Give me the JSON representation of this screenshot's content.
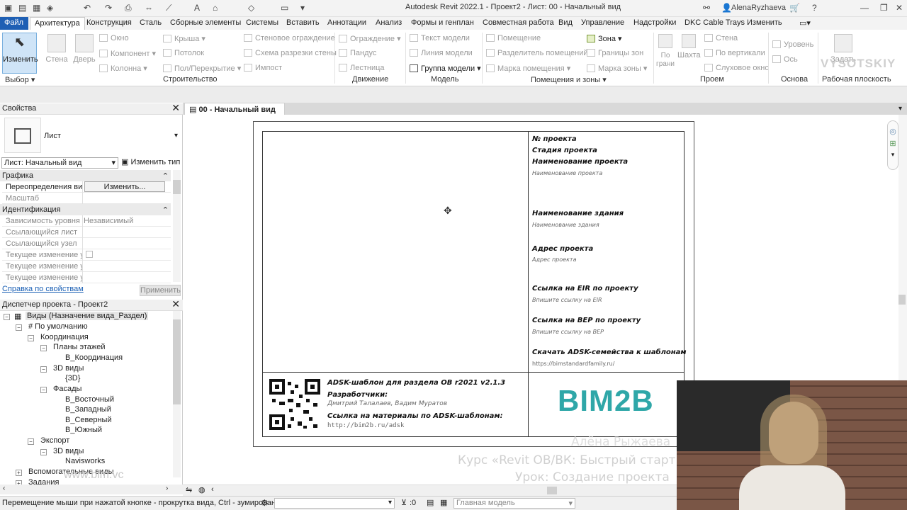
{
  "app": {
    "title": "Autodesk Revit 2022.1 - Проект2 - Лист: 00 - Начальный вид",
    "user": "AlenaRyzhaeva"
  },
  "menu": [
    "Файл",
    "Архитектура",
    "Конструкция",
    "Сталь",
    "Сборные элементы",
    "Системы",
    "Вставить",
    "Аннотации",
    "Анализ",
    "Формы и генплан",
    "Совместная работа",
    "Вид",
    "Управление",
    "Надстройки",
    "DKC Cable Trays",
    "Изменить"
  ],
  "ribbon": {
    "modify": "Изменить",
    "big": [
      "Стена",
      "Дверь"
    ],
    "build": [
      "Окно",
      "Компонент",
      "Колонна",
      "Крыша",
      "Потолок",
      "Пол/Перекрытие",
      "Стеновое ограждение",
      "Схема разрезки стены",
      "Импост"
    ],
    "move": [
      "Ограждение",
      "Пандус",
      "Лестница"
    ],
    "model": [
      "Текст модели",
      "Линия модели",
      "Группа модели"
    ],
    "rooms": [
      "Помещение",
      "Разделитель помещений",
      "Марка помещения",
      "Зона",
      "Границы зон",
      "Марка зоны"
    ],
    "opening": [
      "По грани",
      "Шахта",
      "Стена",
      "По вертикали",
      "Слуховое окно"
    ],
    "base": [
      "Уровень",
      "Ось"
    ],
    "workplane": [
      "Задать"
    ],
    "groups": [
      "Выбор",
      "Строительство",
      "Движение",
      "Модель",
      "Помещения и зоны",
      "Проем",
      "Основа",
      "Рабочая плоскость"
    ]
  },
  "props": {
    "title": "Свойства",
    "type": "Лист",
    "selector": "Лист: Начальный вид",
    "edit_type": "Изменить тип",
    "cat_graphics": "Графика",
    "cat_ident": "Идентификация",
    "rows": [
      {
        "k": "Переопределения ви...",
        "v": "Изменить..."
      },
      {
        "k": "Масштаб",
        "v": ""
      }
    ],
    "rows2": [
      {
        "k": "Зависимость уровня",
        "v": "Независимый"
      },
      {
        "k": "Ссылающийся лист",
        "v": ""
      },
      {
        "k": "Ссылающийся узел",
        "v": ""
      },
      {
        "k": "Текущее изменение у...",
        "v": ""
      },
      {
        "k": "Текущее изменение у...",
        "v": ""
      },
      {
        "k": "Текущее изменение у...",
        "v": ""
      }
    ],
    "help": "Справка по свойствам",
    "apply": "Применить"
  },
  "browser": {
    "title": "Диспетчер проекта - Проект2",
    "items": [
      "Виды (Назначение вида_Раздел)",
      "# По умолчанию",
      "Координация",
      "Планы этажей",
      "В_Координация",
      "3D виды",
      "{3D}",
      "Фасады",
      "В_Восточный",
      "В_Западный",
      "В_Северный",
      "В_Южный",
      "Экспорт",
      "3D виды",
      "Navisworks",
      "Вспомогательные виды",
      "Задания"
    ]
  },
  "view_tab": "00 - Начальный вид",
  "sheet": {
    "labels": [
      "№ проекта",
      "Стадия проекта",
      "Наименование проекта",
      "Наименование проекта",
      "Наименование здания",
      "Наименование здания",
      "Адрес проекта",
      "Адрес проекта",
      "Ссылка на EIR по проекту",
      "Впишите ссылку на EIR",
      "Ссылка на BEP по проекту",
      "Впишите ссылку на BEP",
      "Скачать ADSK-семейства к шаблонам",
      "https://bimstandardfamily.ru/"
    ],
    "bottom": [
      "ADSK-шаблон для раздела ОВ r2021 v2.1.3",
      "Разработчики:",
      "Дмитрий Талалаев, Вадим Муратов",
      "Ссылка на материалы по ADSK-шаблонам:",
      "http://bim2b.ru/adsk"
    ],
    "logo": "BIM2B"
  },
  "overlay": {
    "name": "Алёна Рыжаева",
    "course": "Курс «Revit ОВ/ВК: Быстрый старт»",
    "lesson": "Урок: Создание проекта",
    "site": "www.bim.vc",
    "brand": "VYSOTSKIY"
  },
  "status": {
    "hint": "Перемещение мыши при нажатой кнопке - прокрутка вида, Ctrl - зумирование",
    "zero": ":0",
    "model": "Главная модель"
  }
}
